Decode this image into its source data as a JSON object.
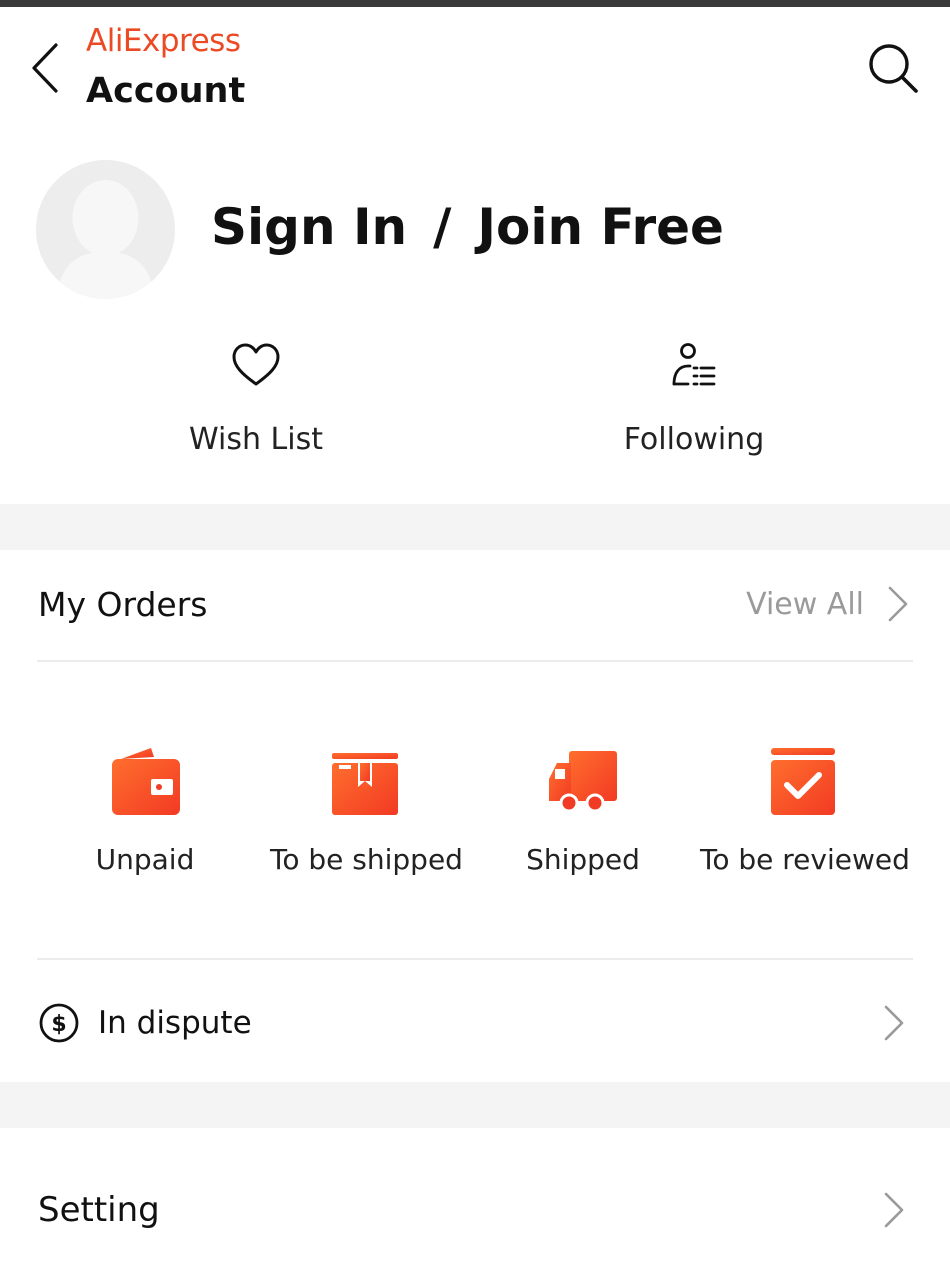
{
  "header": {
    "logo_text": "AliExpress",
    "title": "Account",
    "back_icon": "chevron-left-icon",
    "search_icon": "search-icon"
  },
  "profile": {
    "sign_in": "Sign In",
    "separator": "/",
    "join_free": "Join Free"
  },
  "quick_actions": [
    {
      "label": "Wish List",
      "icon": "heart-icon"
    },
    {
      "label": "Following",
      "icon": "following-icon"
    }
  ],
  "orders": {
    "title": "My Orders",
    "view_all": "View All",
    "items": [
      {
        "label": "Unpaid",
        "icon": "wallet-icon"
      },
      {
        "label": "To be shipped",
        "icon": "package-icon"
      },
      {
        "label": "Shipped",
        "icon": "truck-icon"
      },
      {
        "label": "To be reviewed",
        "icon": "review-check-icon"
      }
    ],
    "dispute": {
      "label": "In dispute",
      "icon": "dollar-circle-icon"
    }
  },
  "setting": {
    "label": "Setting"
  },
  "colors": {
    "brand": "#ec4a25",
    "icon_gradient_start": "#ff6a2c",
    "icon_gradient_end": "#f23b24",
    "muted_text": "#9a9a9a",
    "band": "#f4f4f4"
  }
}
